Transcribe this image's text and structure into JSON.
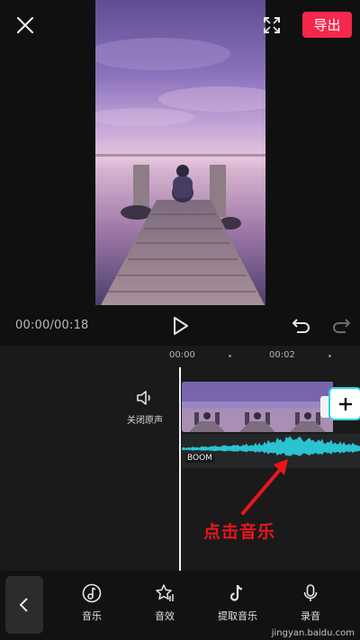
{
  "header": {
    "export_label": "导出"
  },
  "player": {
    "timecode": "00:00/00:18"
  },
  "timeline": {
    "ruler": {
      "t0": "00:00",
      "t1": "00:02"
    },
    "mute_label": "关闭原声",
    "audio_track_label": "BOOM",
    "annotation": "点击音乐"
  },
  "toolbar": {
    "items": [
      {
        "label": "音乐",
        "icon": "music-note-icon"
      },
      {
        "label": "音效",
        "icon": "star-sound-effect-icon"
      },
      {
        "label": "提取音乐",
        "icon": "tiktok-extract-icon"
      },
      {
        "label": "录音",
        "icon": "microphone-icon"
      }
    ]
  },
  "watermark": "jingyan.baidu.com",
  "colors": {
    "accent": "#f5284c",
    "waveform": "#2bc3d1",
    "annotation": "#e8161c"
  }
}
